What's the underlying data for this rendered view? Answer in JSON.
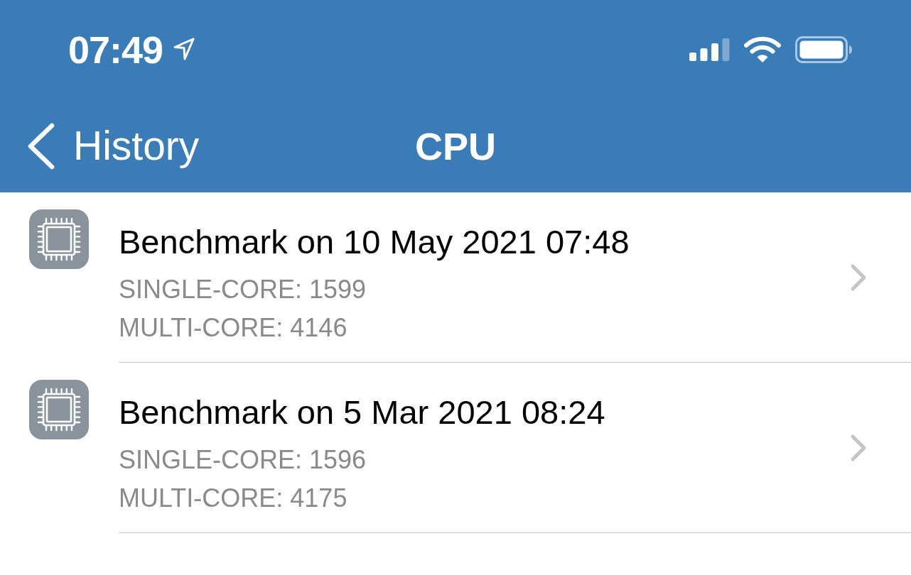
{
  "status_bar": {
    "time": "07:49"
  },
  "nav_bar": {
    "back_label": "History",
    "title": "CPU"
  },
  "benchmarks": [
    {
      "title": "Benchmark on 10 May 2021 07:48",
      "single_core": "SINGLE-CORE: 1599",
      "multi_core": "MULTI-CORE: 4146"
    },
    {
      "title": "Benchmark on 5 Mar 2021 08:24",
      "single_core": "SINGLE-CORE: 1596",
      "multi_core": "MULTI-CORE: 4175"
    }
  ]
}
